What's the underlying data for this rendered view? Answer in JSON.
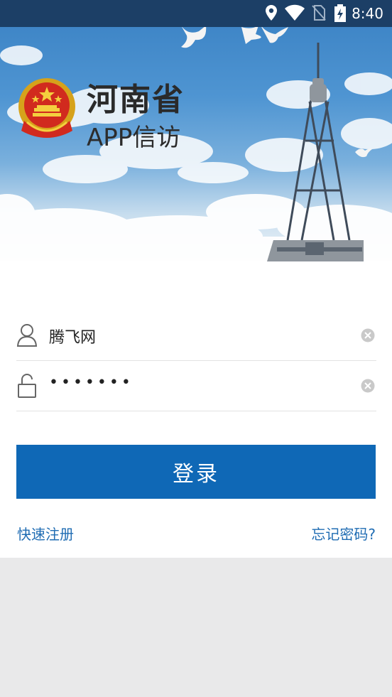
{
  "status_bar": {
    "time": "8:40"
  },
  "header": {
    "title": "河南省",
    "subtitle": "APP信访"
  },
  "form": {
    "username_value": "腾飞网",
    "password_value": "•••••••",
    "login_label": "登录",
    "register_link": "快速注册",
    "forgot_link": "忘记密码?"
  },
  "colors": {
    "status_bar": "#1c3f66",
    "primary_button": "#0f68b6",
    "link": "#1f6cb3",
    "page_bg": "#e9e9ea"
  },
  "icons": [
    "location-icon",
    "wifi-icon",
    "no-sim-icon",
    "battery-charging-icon",
    "national-emblem-icon",
    "user-icon",
    "lock-icon",
    "clear-icon"
  ]
}
